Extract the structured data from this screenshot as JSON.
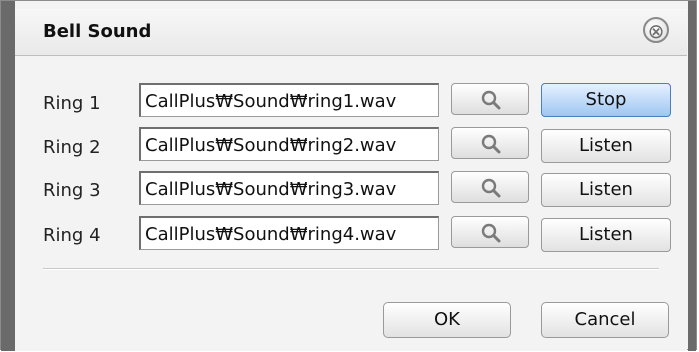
{
  "dialog": {
    "title": "Bell Sound",
    "close_icon": "close-circle-x-icon"
  },
  "rings": [
    {
      "label": "Ring 1",
      "path": "CallPlus₩Sound₩ring1.wav",
      "action": "Stop",
      "active": true
    },
    {
      "label": "Ring 2",
      "path": "CallPlus₩Sound₩ring2.wav",
      "action": "Listen",
      "active": false
    },
    {
      "label": "Ring 3",
      "path": "CallPlus₩Sound₩ring3.wav",
      "action": "Listen",
      "active": false
    },
    {
      "label": "Ring 4",
      "path": "CallPlus₩Sound₩ring4.wav",
      "action": "Listen",
      "active": false
    }
  ],
  "browse_icon": "magnifier-search-icon",
  "footer": {
    "ok_label": "OK",
    "cancel_label": "Cancel"
  },
  "colors": {
    "active_button": "#9ec6f2",
    "frame": "#6a6a6a"
  }
}
